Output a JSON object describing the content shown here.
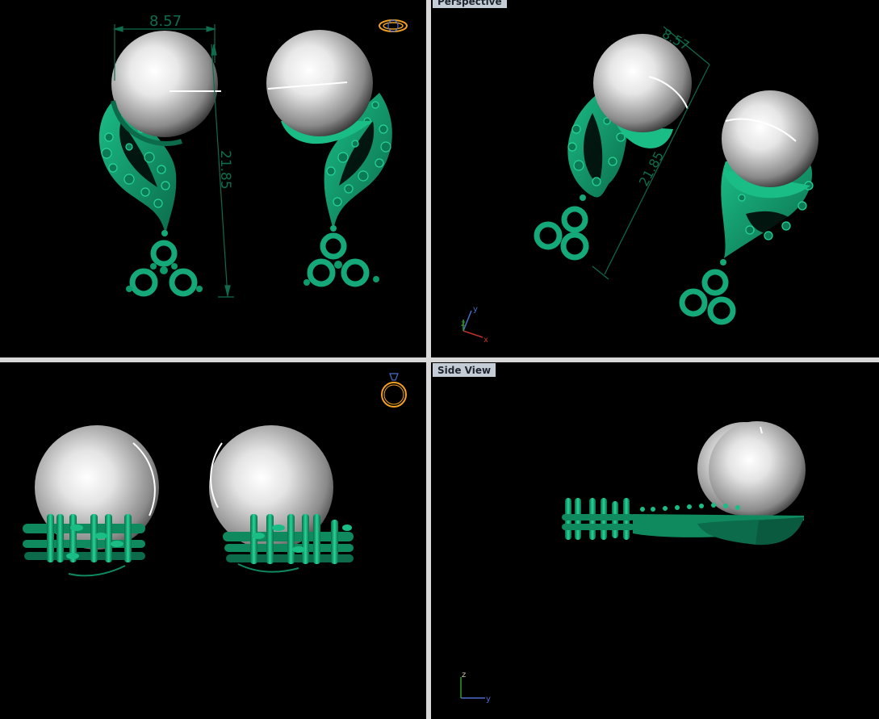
{
  "viewports": {
    "top": {
      "dimensions": {
        "width": "8.57",
        "height": "21.85"
      }
    },
    "perspective": {
      "label": "Perspective",
      "dimensions": {
        "width": "8.57",
        "height": "21.85"
      },
      "axes": {
        "x": "x",
        "y": "y",
        "z": "z"
      }
    },
    "front": {},
    "side": {
      "label": "Side View",
      "axes": {
        "z": "z",
        "y": "y"
      }
    }
  },
  "colors": {
    "background": "#000000",
    "metal": "#15a878",
    "metal_dark": "#0a5a3f",
    "pearl": "#f2f2f2",
    "dimension": "#0f6c4c",
    "divider": "#d8d8d8",
    "label_bg": "#c4ccd6",
    "nav_icon": "#f0a020"
  },
  "icons": {
    "top_nav": "ring-top-view-icon",
    "front_nav": "ring-front-view-icon"
  }
}
